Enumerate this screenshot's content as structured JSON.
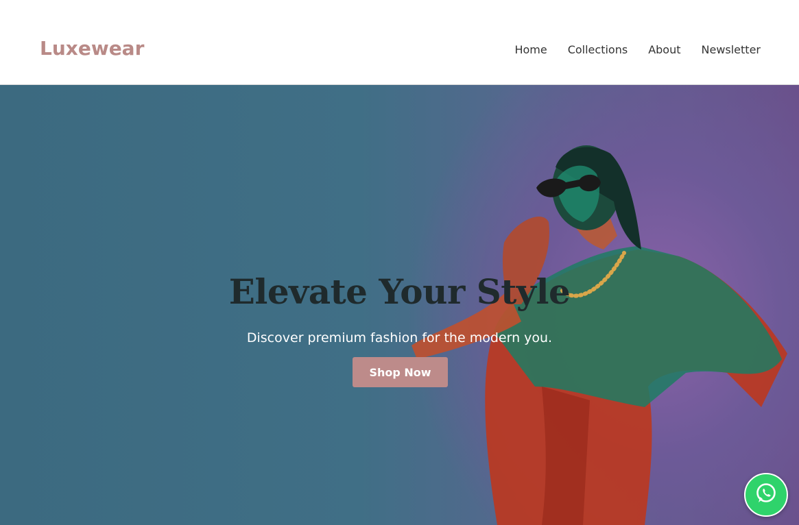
{
  "brand": {
    "name": "Luxewear",
    "color": "#b98a87"
  },
  "nav": {
    "items": [
      {
        "label": "Home"
      },
      {
        "label": "Collections"
      },
      {
        "label": "About"
      },
      {
        "label": "Newsletter"
      }
    ]
  },
  "hero": {
    "title": "Elevate Your Style",
    "subtitle": "Discover premium fashion for the modern you.",
    "cta_label": "Shop Now",
    "cta_color": "#bd8b8a"
  },
  "floating": {
    "icon": "whatsapp-icon",
    "color": "#2fd36b"
  }
}
